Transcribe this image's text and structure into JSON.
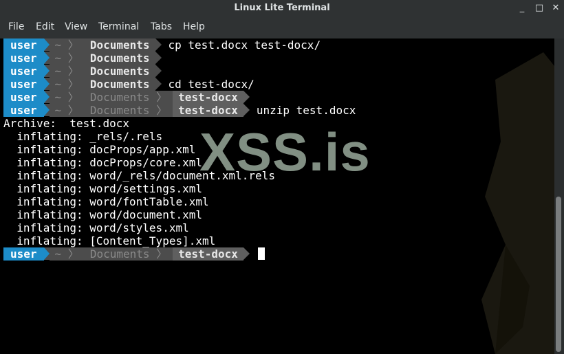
{
  "window": {
    "title": "Linux Lite Terminal",
    "minimize": "_",
    "maximize": "□",
    "close": "✕"
  },
  "menu": [
    "File",
    "Edit",
    "View",
    "Terminal",
    "Tabs",
    "Help"
  ],
  "prompt": {
    "user": "user",
    "tilde": "~",
    "sep": "〉"
  },
  "lines": [
    {
      "kind": "prompt",
      "dirs": [
        "Documents"
      ],
      "cmd": "cp test.docx test-docx/"
    },
    {
      "kind": "prompt",
      "dirs": [
        "Documents"
      ],
      "cmd": ""
    },
    {
      "kind": "prompt",
      "dirs": [
        "Documents"
      ],
      "cmd": ""
    },
    {
      "kind": "prompt",
      "dirs": [
        "Documents"
      ],
      "cmd": "cd test-docx/"
    },
    {
      "kind": "prompt",
      "dirs": [
        "Documents",
        "test-docx"
      ],
      "cmd": ""
    },
    {
      "kind": "prompt",
      "dirs": [
        "Documents",
        "test-docx"
      ],
      "cmd": "unzip test.docx"
    },
    {
      "kind": "output",
      "text": "Archive:  test.docx"
    },
    {
      "kind": "output",
      "text": "  inflating: _rels/.rels"
    },
    {
      "kind": "output",
      "text": "  inflating: docProps/app.xml"
    },
    {
      "kind": "output",
      "text": "  inflating: docProps/core.xml"
    },
    {
      "kind": "output",
      "text": "  inflating: word/_rels/document.xml.rels"
    },
    {
      "kind": "output",
      "text": "  inflating: word/settings.xml"
    },
    {
      "kind": "output",
      "text": "  inflating: word/fontTable.xml"
    },
    {
      "kind": "output",
      "text": "  inflating: word/document.xml"
    },
    {
      "kind": "output",
      "text": "  inflating: word/styles.xml"
    },
    {
      "kind": "output",
      "text": "  inflating: [Content_Types].xml"
    },
    {
      "kind": "prompt",
      "dirs": [
        "Documents",
        "test-docx"
      ],
      "cmd": "",
      "cursor": true
    }
  ],
  "watermark": "XSS.is",
  "colors": {
    "user_bg": "#1d8cc8",
    "dir_bg": "#4c4c4c",
    "terminal_bg": "#000000",
    "chrome_bg": "#2f3233"
  }
}
